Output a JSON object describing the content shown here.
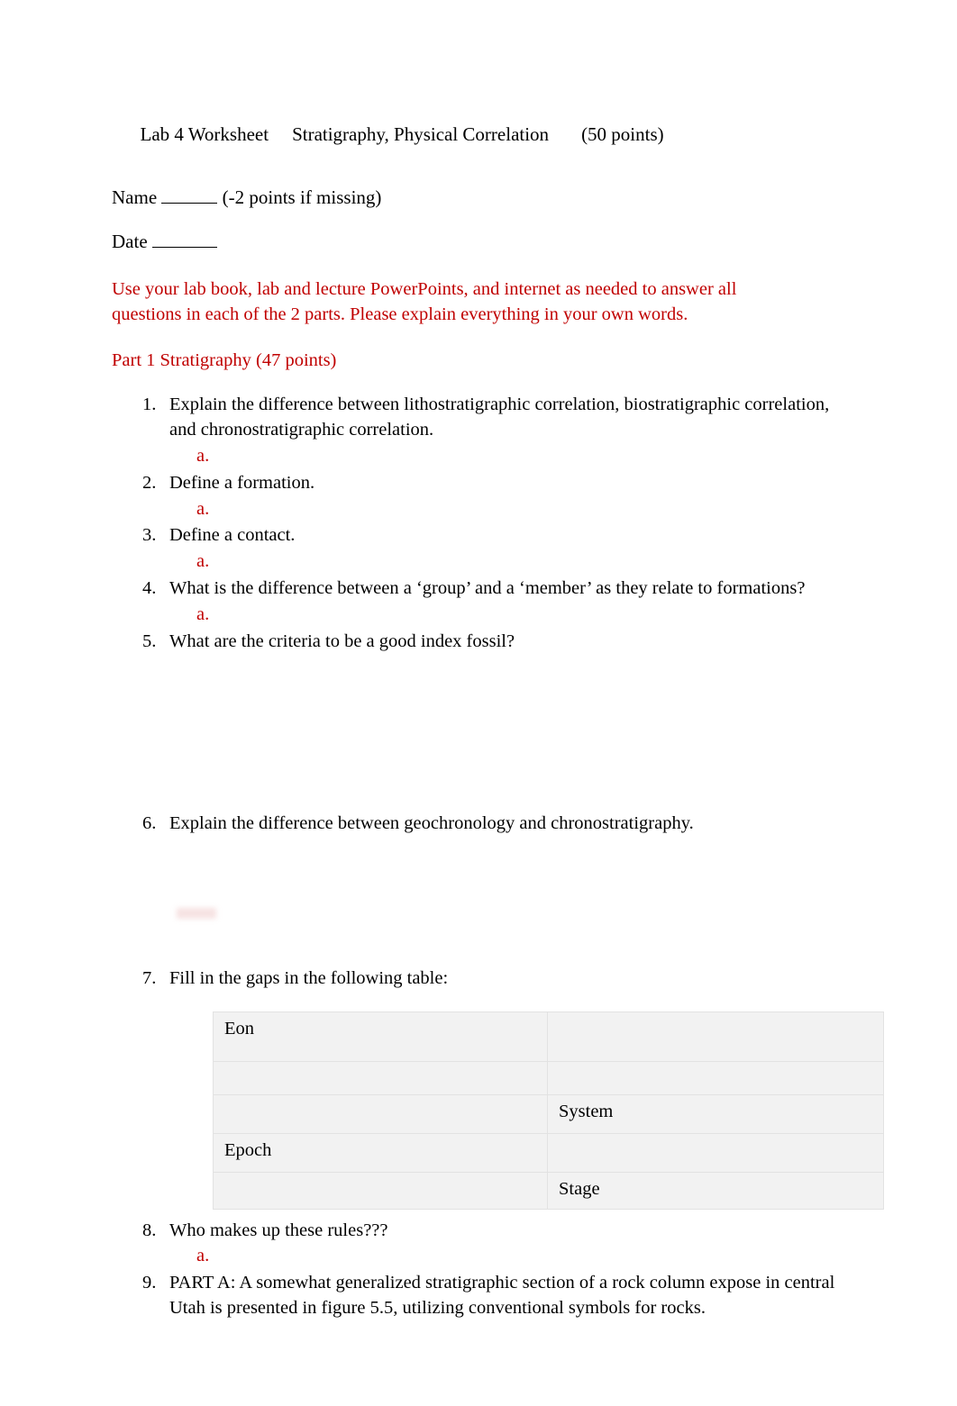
{
  "document": {
    "header": {
      "title": "Lab 4 Worksheet",
      "subtitle": "Stratigraphy, Physical Correlation",
      "points": "(50 points)",
      "name_label": "Name",
      "name_note": "(-2 points if missing)",
      "date_label": "Date"
    },
    "instructions": "Use your lab book, lab and lecture PowerPoints, and internet as needed to answer all questions in each of the 2 parts. Please explain everything in your own words.",
    "part_heading": "Part 1 Stratigraphy (47 points)",
    "sub_marker": "a.",
    "questions": [
      {
        "num": "1.",
        "text": "Explain the difference between lithostratigraphic correlation, biostratigraphic correlation, and chronostratigraphic correlation.",
        "has_sub": true
      },
      {
        "num": "2.",
        "text": "Define a formation.",
        "has_sub": true
      },
      {
        "num": "3.",
        "text": "Define a contact.",
        "has_sub": true
      },
      {
        "num": "4.",
        "text": "What is the difference between a ‘group’ and a ‘member’ as they relate to formations?",
        "has_sub": true
      },
      {
        "num": "5.",
        "text": "What are the criteria to be a good index fossil?",
        "has_sub": false
      },
      {
        "num": "6.",
        "text": "Explain the difference between geochronology and chronostratigraphy.",
        "has_sub": false
      },
      {
        "num": "7.",
        "text": "Fill in the gaps in the following table:",
        "has_sub": false
      },
      {
        "num": "8.",
        "text": "Who makes up these rules???",
        "has_sub": true
      },
      {
        "num": "9.",
        "text": "PART A: A somewhat generalized stratigraphic section of a rock column expose in central Utah is presented in figure 5.5, utilizing conventional symbols for rocks.",
        "has_sub": false
      }
    ],
    "table": {
      "rows": [
        {
          "left": "Eon",
          "right": ""
        },
        {
          "left": "",
          "right": ""
        },
        {
          "left": "",
          "right": "System"
        },
        {
          "left": "Epoch",
          "right": ""
        },
        {
          "left": "",
          "right": "Stage"
        }
      ]
    },
    "colors": {
      "red_text": "#C00000",
      "body_text": "#000000",
      "table_fill": "#F2F2F2",
      "table_border": "#E2E2E2",
      "page_background": "#FFFFFF"
    }
  }
}
